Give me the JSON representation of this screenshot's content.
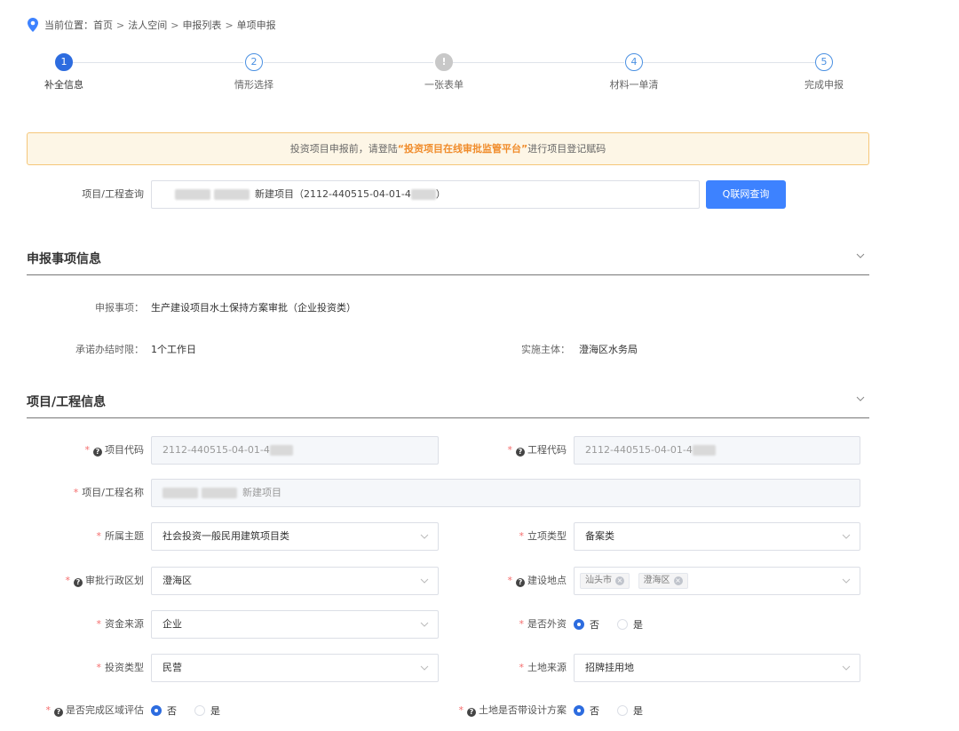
{
  "breadcrumb": {
    "prefix": "当前位置：",
    "items": [
      "首页",
      "法人空间",
      "申报列表",
      "单项申报"
    ],
    "separator": ">"
  },
  "steps": [
    {
      "num": "1",
      "label": "补全信息",
      "state": "active"
    },
    {
      "num": "2",
      "label": "情形选择",
      "state": "pending"
    },
    {
      "num": "!",
      "label": "一张表单",
      "state": "error"
    },
    {
      "num": "4",
      "label": "材料一单清",
      "state": "pending"
    },
    {
      "num": "5",
      "label": "完成申报",
      "state": "pending"
    }
  ],
  "notice": {
    "before": "投资项目申报前，请登陆",
    "highlight": "“投资项目在线审批监管平台”",
    "after": "进行项目登记赋码"
  },
  "query": {
    "label": "项目/工程查询",
    "value_mid": "新建项目（2112-440515-04-01-4",
    "value_end": "）",
    "button": "Q联网查询"
  },
  "section1": {
    "title": "申报事项信息",
    "item_label": "申报事项：",
    "item_value": "生产建设项目水土保持方案审批（企业投资类）",
    "deadline_label": "承诺办结时限：",
    "deadline_value": "1个工作日",
    "authority_label": "实施主体：",
    "authority_value": "澄海区水务局"
  },
  "section2": {
    "title": "项目/工程信息",
    "project_code_label": "项目代码",
    "project_code_value": "2112-440515-04-01-4",
    "engineering_code_label": "工程代码",
    "engineering_code_value": "2112-440515-04-01-4",
    "project_name_label": "项目/工程名称",
    "project_name_value": "新建项目",
    "theme_label": "所属主题",
    "theme_value": "社会投资一般民用建筑项目类",
    "approval_type_label": "立项类型",
    "approval_type_value": "备案类",
    "district_label": "审批行政区划",
    "district_value": "澄海区",
    "location_label": "建设地点",
    "location_tags": [
      "汕头市",
      "澄海区"
    ],
    "funding_label": "资金来源",
    "funding_value": "企业",
    "foreign_label": "是否外资",
    "invest_type_label": "投资类型",
    "invest_type_value": "民营",
    "land_source_label": "土地来源",
    "land_source_value": "招牌挂用地",
    "regional_eval_label": "是否完成区域评估",
    "land_design_label": "土地是否带设计方案",
    "radio_no": "否",
    "radio_yes": "是"
  },
  "colors": {
    "primary": "#3d82ff",
    "warning_text": "#f08c2b",
    "required": "#f56c6c"
  }
}
